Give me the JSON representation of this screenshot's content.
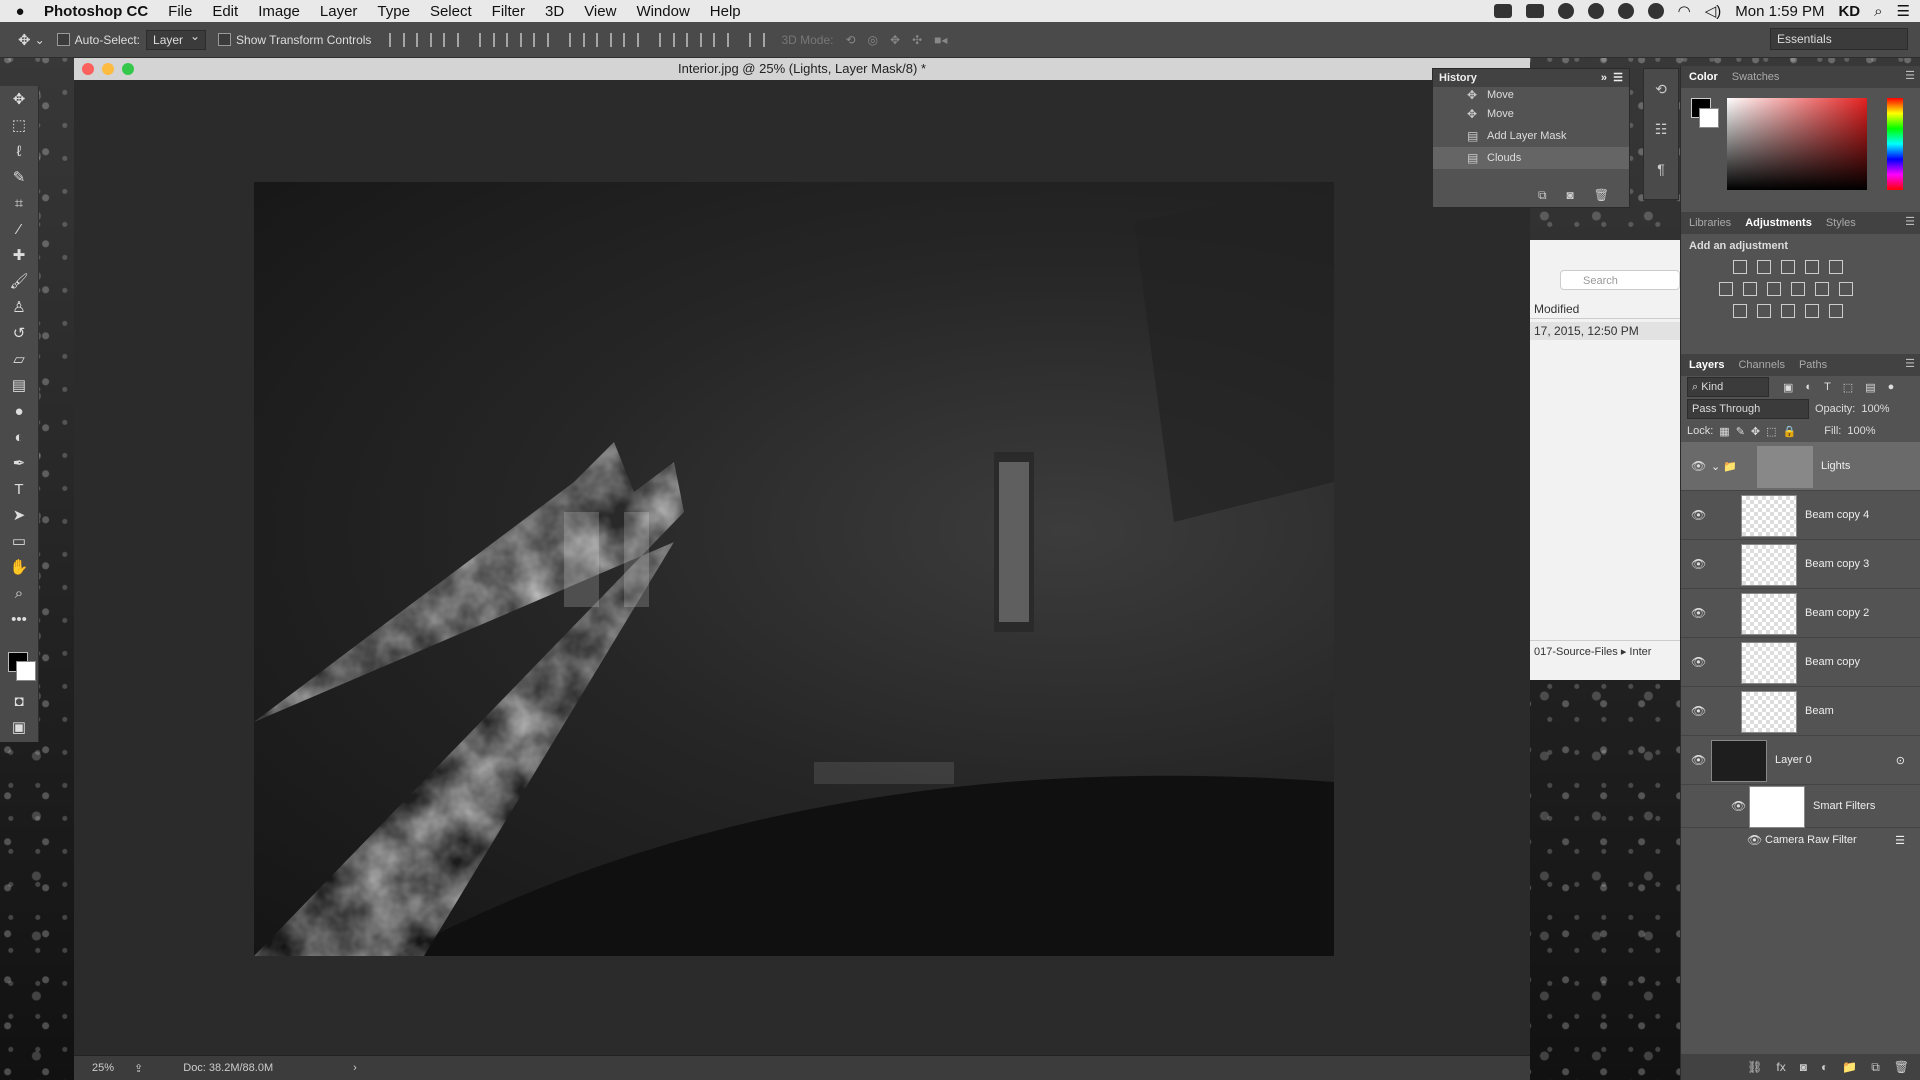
{
  "menubar": {
    "app": "Photoshop CC",
    "items": [
      "File",
      "Edit",
      "Image",
      "Layer",
      "Type",
      "Select",
      "Filter",
      "3D",
      "View",
      "Window",
      "Help"
    ],
    "clock": "Mon 1:59 PM",
    "user": "KD"
  },
  "options": {
    "auto_select": "Auto-Select:",
    "auto_select_value": "Layer",
    "show_transform": "Show Transform Controls",
    "mode_3d": "3D Mode:",
    "workspace": "Essentials"
  },
  "document": {
    "title": "Interior.jpg @ 25% (Lights, Layer Mask/8) *",
    "zoom": "25%",
    "doc_size": "Doc: 38.2M/88.0M"
  },
  "history": {
    "title": "History",
    "items": [
      "Move",
      "Move",
      "Add Layer Mask",
      "Clouds"
    ]
  },
  "finder": {
    "search": "Search",
    "modified_header": "Modified",
    "modified_value": "17, 2015, 12:50 PM",
    "path_a": "017-Source-Files",
    "path_b": "Inter"
  },
  "color_panel": {
    "tabs": [
      "Color",
      "Swatches"
    ]
  },
  "adjust_panel": {
    "tabs": [
      "Libraries",
      "Adjustments",
      "Styles"
    ],
    "label": "Add an adjustment"
  },
  "layers_panel": {
    "tabs": [
      "Layers",
      "Channels",
      "Paths"
    ],
    "kind": "Kind",
    "blend_mode": "Pass Through",
    "opacity_label": "Opacity:",
    "opacity": "100%",
    "lock_label": "Lock:",
    "fill_label": "Fill:",
    "fill": "100%",
    "layers": [
      {
        "name": "Lights"
      },
      {
        "name": "Beam copy 4"
      },
      {
        "name": "Beam copy 3"
      },
      {
        "name": "Beam copy 2"
      },
      {
        "name": "Beam copy"
      },
      {
        "name": "Beam"
      },
      {
        "name": "Layer 0"
      },
      {
        "name": "Smart Filters"
      },
      {
        "name": "Camera Raw Filter"
      }
    ]
  }
}
